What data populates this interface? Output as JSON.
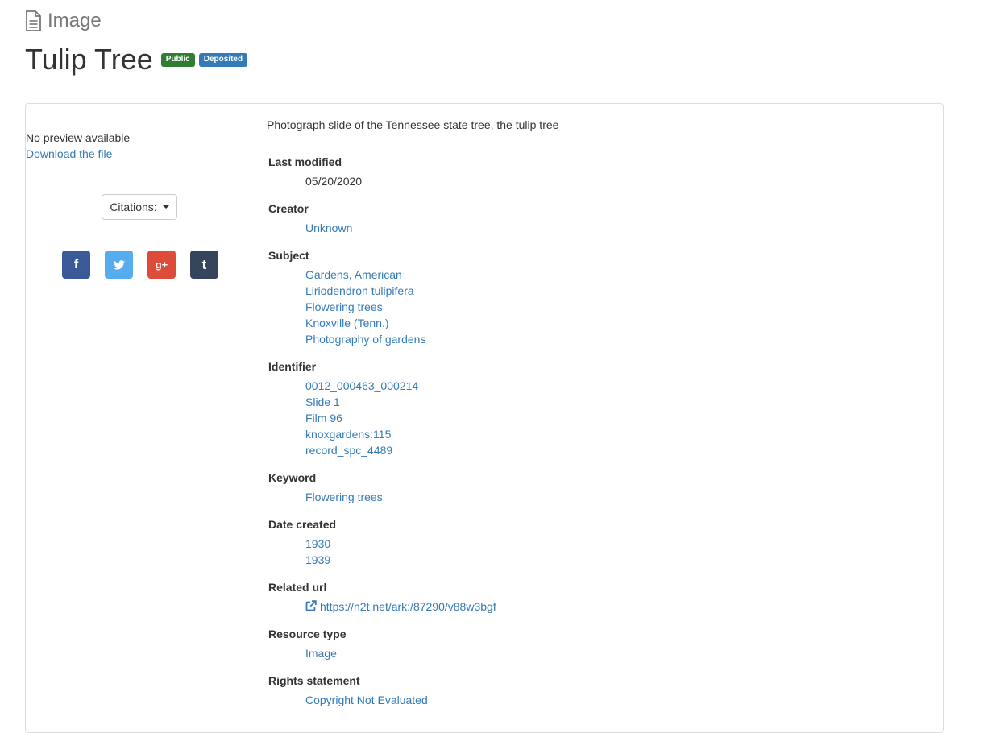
{
  "header": {
    "type_label": "Image",
    "title": "Tulip Tree",
    "badges": [
      "Public",
      "Deposited"
    ]
  },
  "preview": {
    "no_preview": "No preview available",
    "download": "Download the file",
    "citations": "Citations:"
  },
  "share": {
    "facebook": "f",
    "twitter": "twitter-icon",
    "googleplus": "g+",
    "tumblr": "t"
  },
  "description": "Photograph slide of the Tennessee state tree, the tulip tree",
  "metadata": [
    {
      "label": "Last modified",
      "values": [
        "05/20/2020"
      ],
      "link": false
    },
    {
      "label": "Creator",
      "values": [
        "Unknown"
      ],
      "link": true
    },
    {
      "label": "Subject",
      "values": [
        "Gardens, American",
        "Liriodendron tulipifera",
        "Flowering trees",
        "Knoxville (Tenn.)",
        "Photography of gardens"
      ],
      "link": true
    },
    {
      "label": "Identifier",
      "values": [
        "0012_000463_000214",
        "Slide 1",
        "Film 96",
        "knoxgardens:115",
        "record_spc_4489"
      ],
      "link": true
    },
    {
      "label": "Keyword",
      "values": [
        "Flowering trees"
      ],
      "link": true
    },
    {
      "label": "Date created",
      "values": [
        "1930",
        "1939"
      ],
      "link": true
    },
    {
      "label": "Related url",
      "values": [
        "https://n2t.net/ark:/87290/v88w3bgf"
      ],
      "link": true,
      "external": true
    },
    {
      "label": "Resource type",
      "values": [
        "Image"
      ],
      "link": true
    },
    {
      "label": "Rights statement",
      "values": [
        "Copyright Not Evaluated"
      ],
      "link": true
    }
  ],
  "colors": {
    "link": "#337ab7",
    "badge_public": "#2e7d32",
    "badge_deposited": "#337ab7",
    "facebook": "#3b5998",
    "twitter": "#55acee",
    "googleplus": "#dd4b39",
    "tumblr": "#35465c"
  }
}
